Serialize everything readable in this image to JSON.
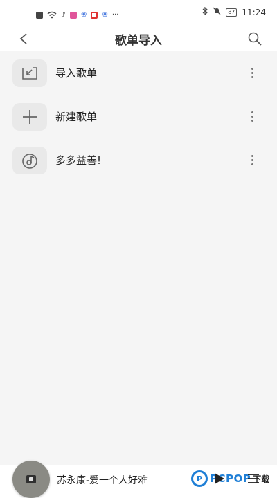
{
  "status_bar": {
    "time": "11:24",
    "battery": "87",
    "overflow": "···"
  },
  "header": {
    "title": "歌单导入",
    "back_icon": "chevron-left-icon",
    "search_icon": "search-icon"
  },
  "playlists": [
    {
      "label": "导入歌单",
      "icon": "import-arrow-icon"
    },
    {
      "label": "新建歌单",
      "icon": "plus-icon"
    },
    {
      "label": "多多益善!",
      "icon": "disc-note-icon"
    }
  ],
  "player": {
    "song": "苏永康-爱一个人好难",
    "play_icon": "play-icon",
    "queue_icon": "playlist-queue-icon"
  },
  "watermark": {
    "logo_letter": "P",
    "brand": "PCPOP",
    "suffix": "下载"
  },
  "colors": {
    "background": "#f5f5f5",
    "icon_tile": "#e9e9e9",
    "watermark_blue": "#1f7fd6"
  }
}
